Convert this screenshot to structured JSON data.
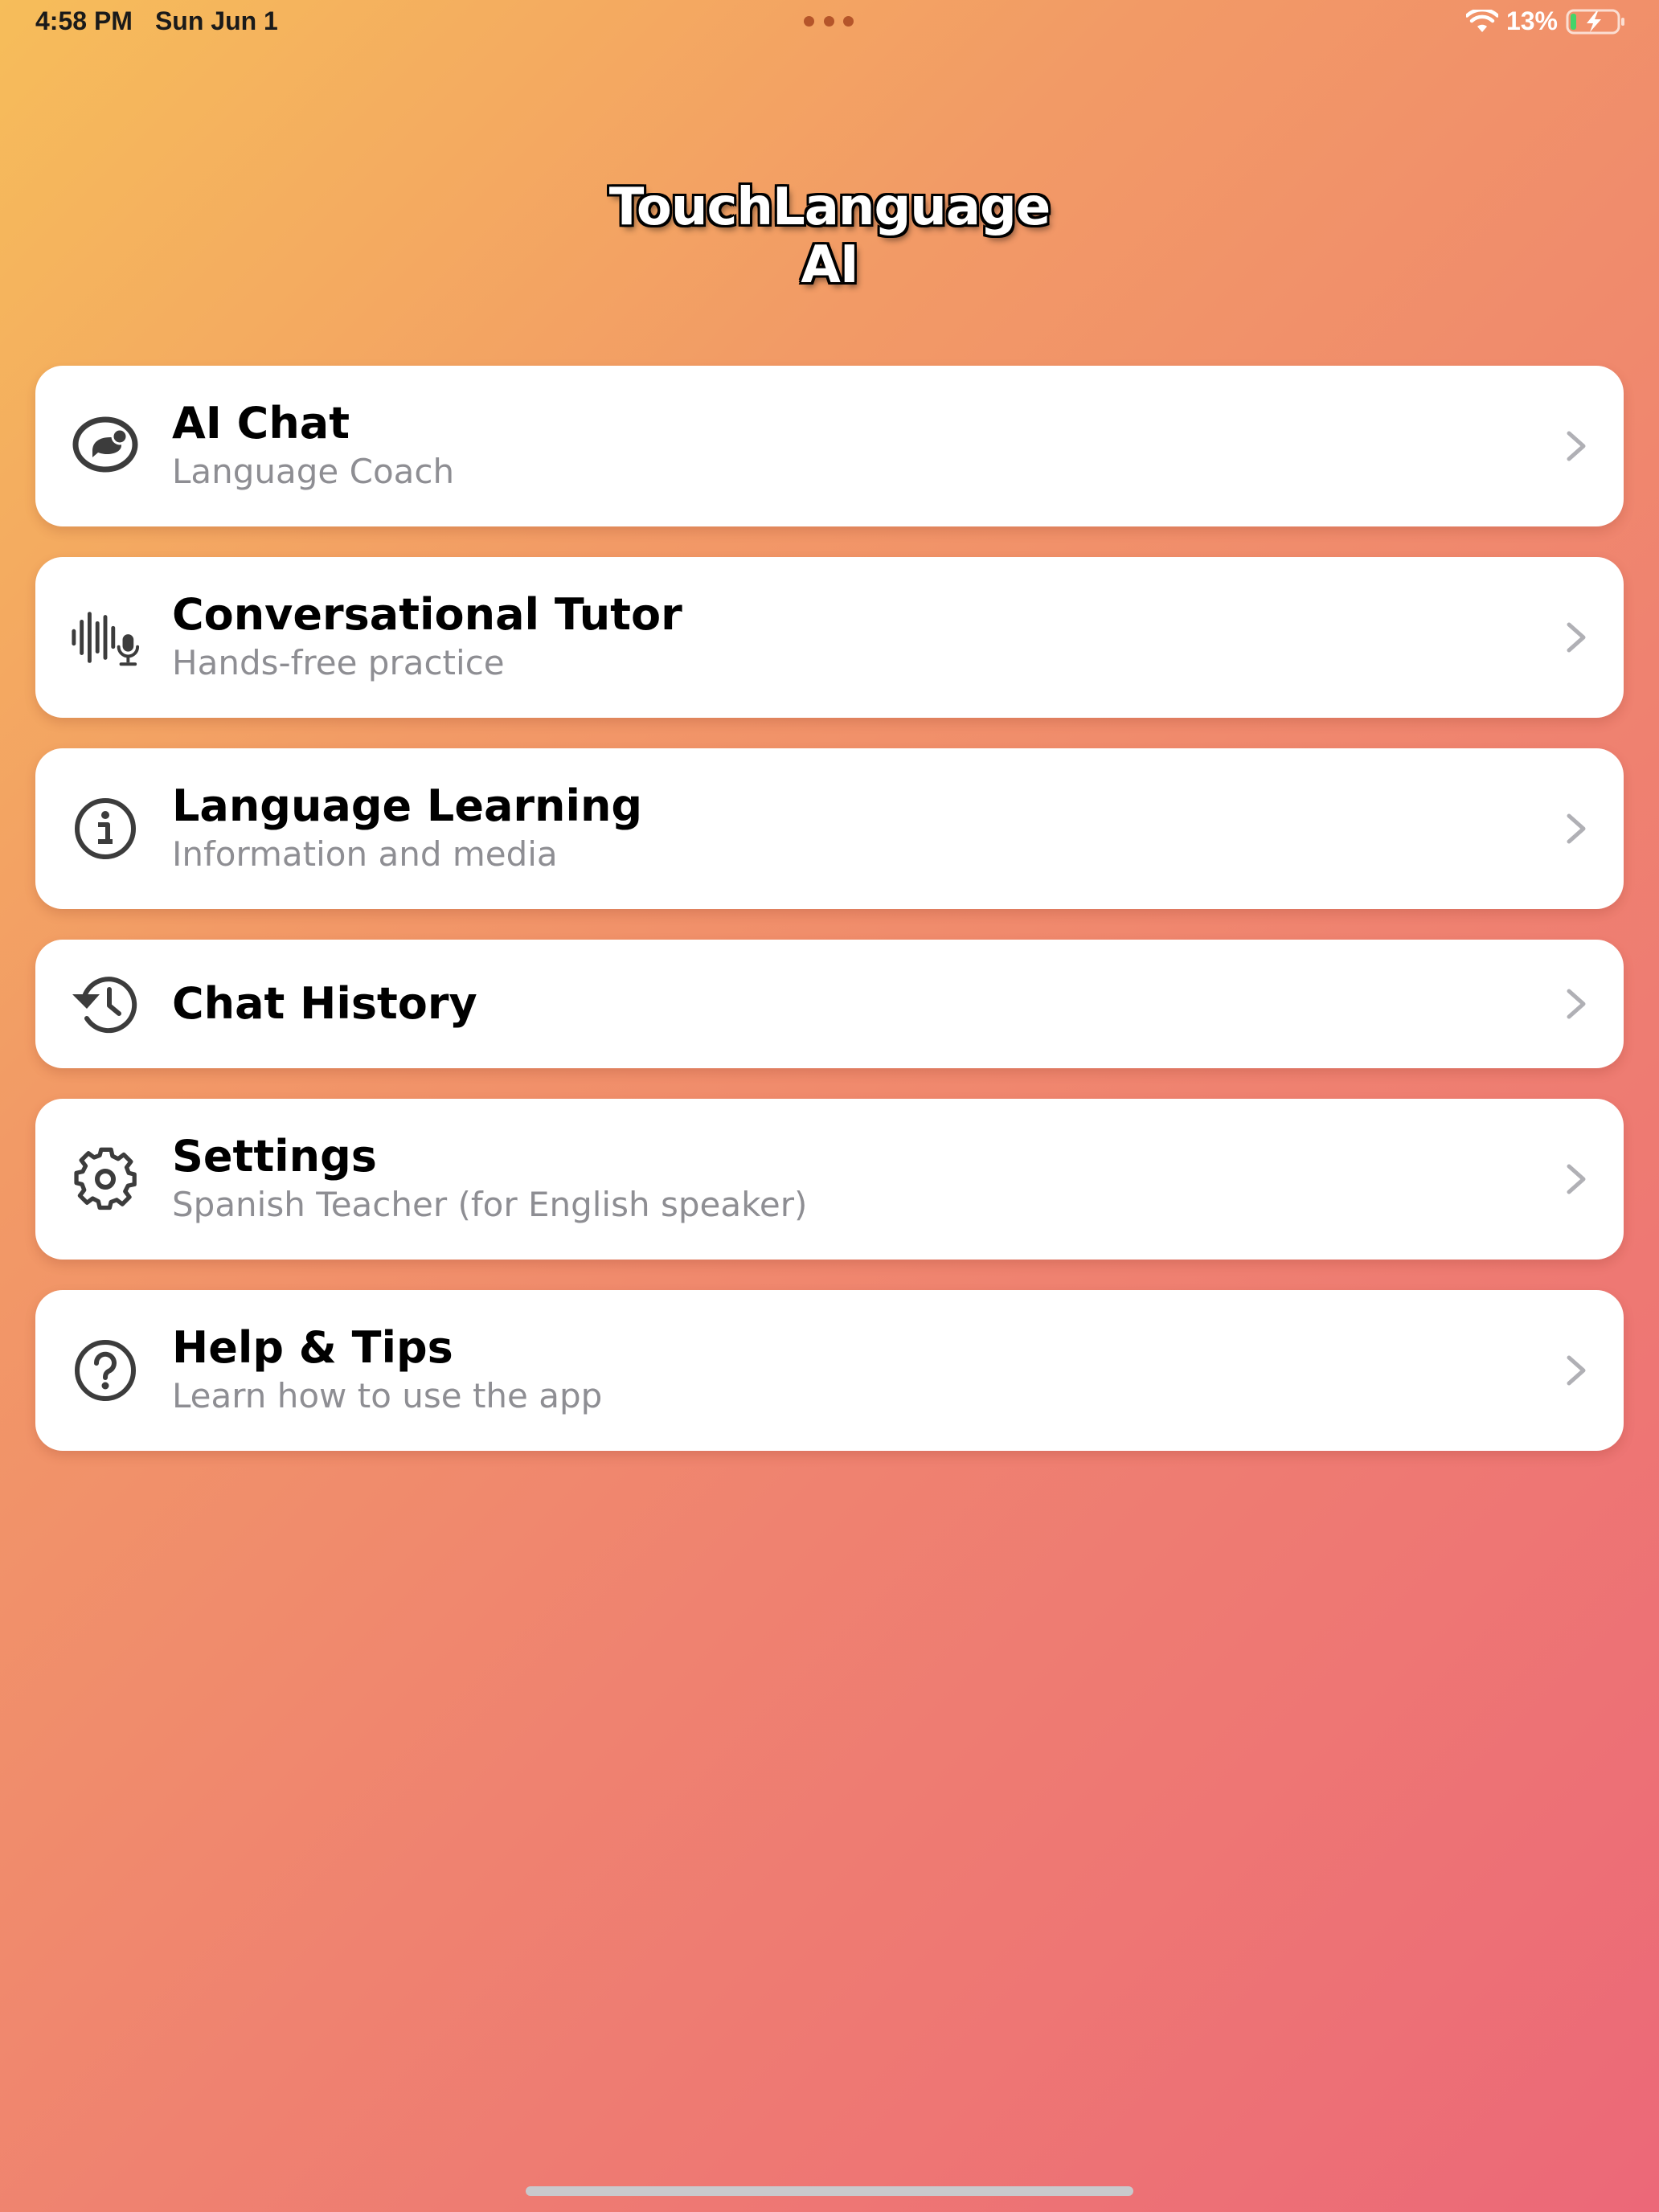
{
  "status_bar": {
    "time": "4:58 PM",
    "date": "Sun Jun 1",
    "battery_percent": "13%"
  },
  "app": {
    "title_line1": "TouchLanguage",
    "title_line2": "AI"
  },
  "menu": {
    "items": [
      {
        "title": "AI Chat",
        "subtitle": "Language Coach",
        "icon": "speech-bubble-icon"
      },
      {
        "title": "Conversational Tutor",
        "subtitle": "Hands-free practice",
        "icon": "waveform-mic-icon"
      },
      {
        "title": "Language Learning",
        "subtitle": "Information and media",
        "icon": "info-icon"
      },
      {
        "title": "Chat History",
        "subtitle": "",
        "icon": "history-clock-icon"
      },
      {
        "title": "Settings",
        "subtitle": "Spanish Teacher (for English speaker)",
        "icon": "gear-icon"
      },
      {
        "title": "Help & Tips",
        "subtitle": "Learn how to use the app",
        "icon": "question-icon"
      }
    ]
  },
  "colors": {
    "gradient_start": "#f6bd5a",
    "gradient_end": "#ec6878",
    "icon_color": "#3c3c3c",
    "subtitle_color": "#8e8e93",
    "chevron_color": "#b0b0b5"
  }
}
